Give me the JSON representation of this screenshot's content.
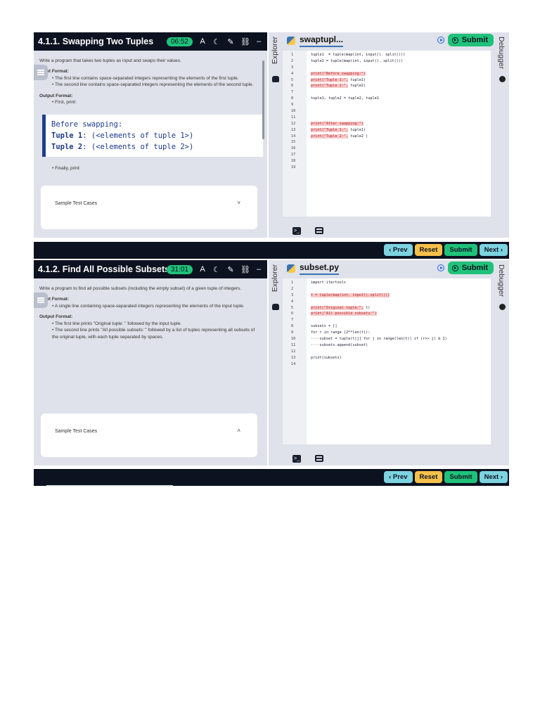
{
  "problems": [
    {
      "title": "4.1.1. Swapping Two Tuples",
      "timer": "06:52",
      "desc_intro": "Write a program that takes two tuples as input and swaps their values.",
      "input_heading": "Input Format:",
      "input_bullets": [
        "The first line contains space-separated integers representing the elements of the first tuple.",
        "The second line contains space-separated integers representing the elements of the second tuple."
      ],
      "output_heading": "Output Format:",
      "output_bullets": [
        "First, print:"
      ],
      "code_example": [
        {
          "kw": "",
          "rest": "Before swapping:"
        },
        {
          "kw": "Tuple 1",
          "rest": ": (<elements of tuple 1>)"
        },
        {
          "kw": "Tuple 2",
          "rest": ": (<elements of tuple 2>)"
        }
      ],
      "finally": "Finally, print:",
      "sample_label": "Sample Test Cases",
      "file_name": "swaptupl...",
      "code_lines": [
        "tuple1  = tuple(map(int, input(). split()))",
        "tuple2 = tuple(map(int, input(). split()))",
        "",
        "print(\"Before swapping:\")",
        "print(\"Tuple 1:\", tuple1)",
        "print(\"Tuple 2:\", tuple2)",
        "",
        "tuple1, tuple2 = tuple2, tuple1",
        "",
        "",
        "",
        "print(\"After swapping:\")",
        "print(\"Tuple 1:\", tuple1)",
        "print(\"Tuple 2:\", tuple2 )",
        "",
        "",
        "",
        "",
        ""
      ]
    },
    {
      "title": "4.1.2. Find All Possible Subsets...",
      "timer": "31:01",
      "desc_intro": "Write a program to find all possible subsets (including the empty subset) of a given tuple of integers.",
      "input_heading": "Input Format:",
      "input_bullets": [
        "A single line containing space-separated integers representing the elements of the input tuple."
      ],
      "output_heading": "Output Format:",
      "output_bullets": [
        "The first line prints \"Original tuple: \" followed by the input tuple.",
        "The second line prints \"All possible subsets: \" followed by a list of tuples representing all subsets of the original tuple, with each tuple separated by spaces."
      ],
      "sample_label": "Sample Test Cases",
      "file_name": "subset.py",
      "code_lines": [
        "import itertools",
        "",
        "t = tuple(map(int, input().split()))",
        "",
        "print(\"Original tuple:\", t)",
        "print(\"All possible subsets:\")",
        "",
        "subsets = []",
        "for r in range (2**len(t)):",
        "····subset = tuple(t[j] for j in range(len(t)) if (r>> j) & 1)",
        "····subsets.append(subset)",
        "",
        "print(subsets)",
        ""
      ]
    }
  ],
  "ui": {
    "explorer": "Explorer",
    "debugger": "Debugger",
    "submit": "Submit",
    "prev": "‹ Prev",
    "reset": "Reset",
    "next": "Next ›",
    "caret_down": "˅",
    "caret_up": "˄"
  }
}
